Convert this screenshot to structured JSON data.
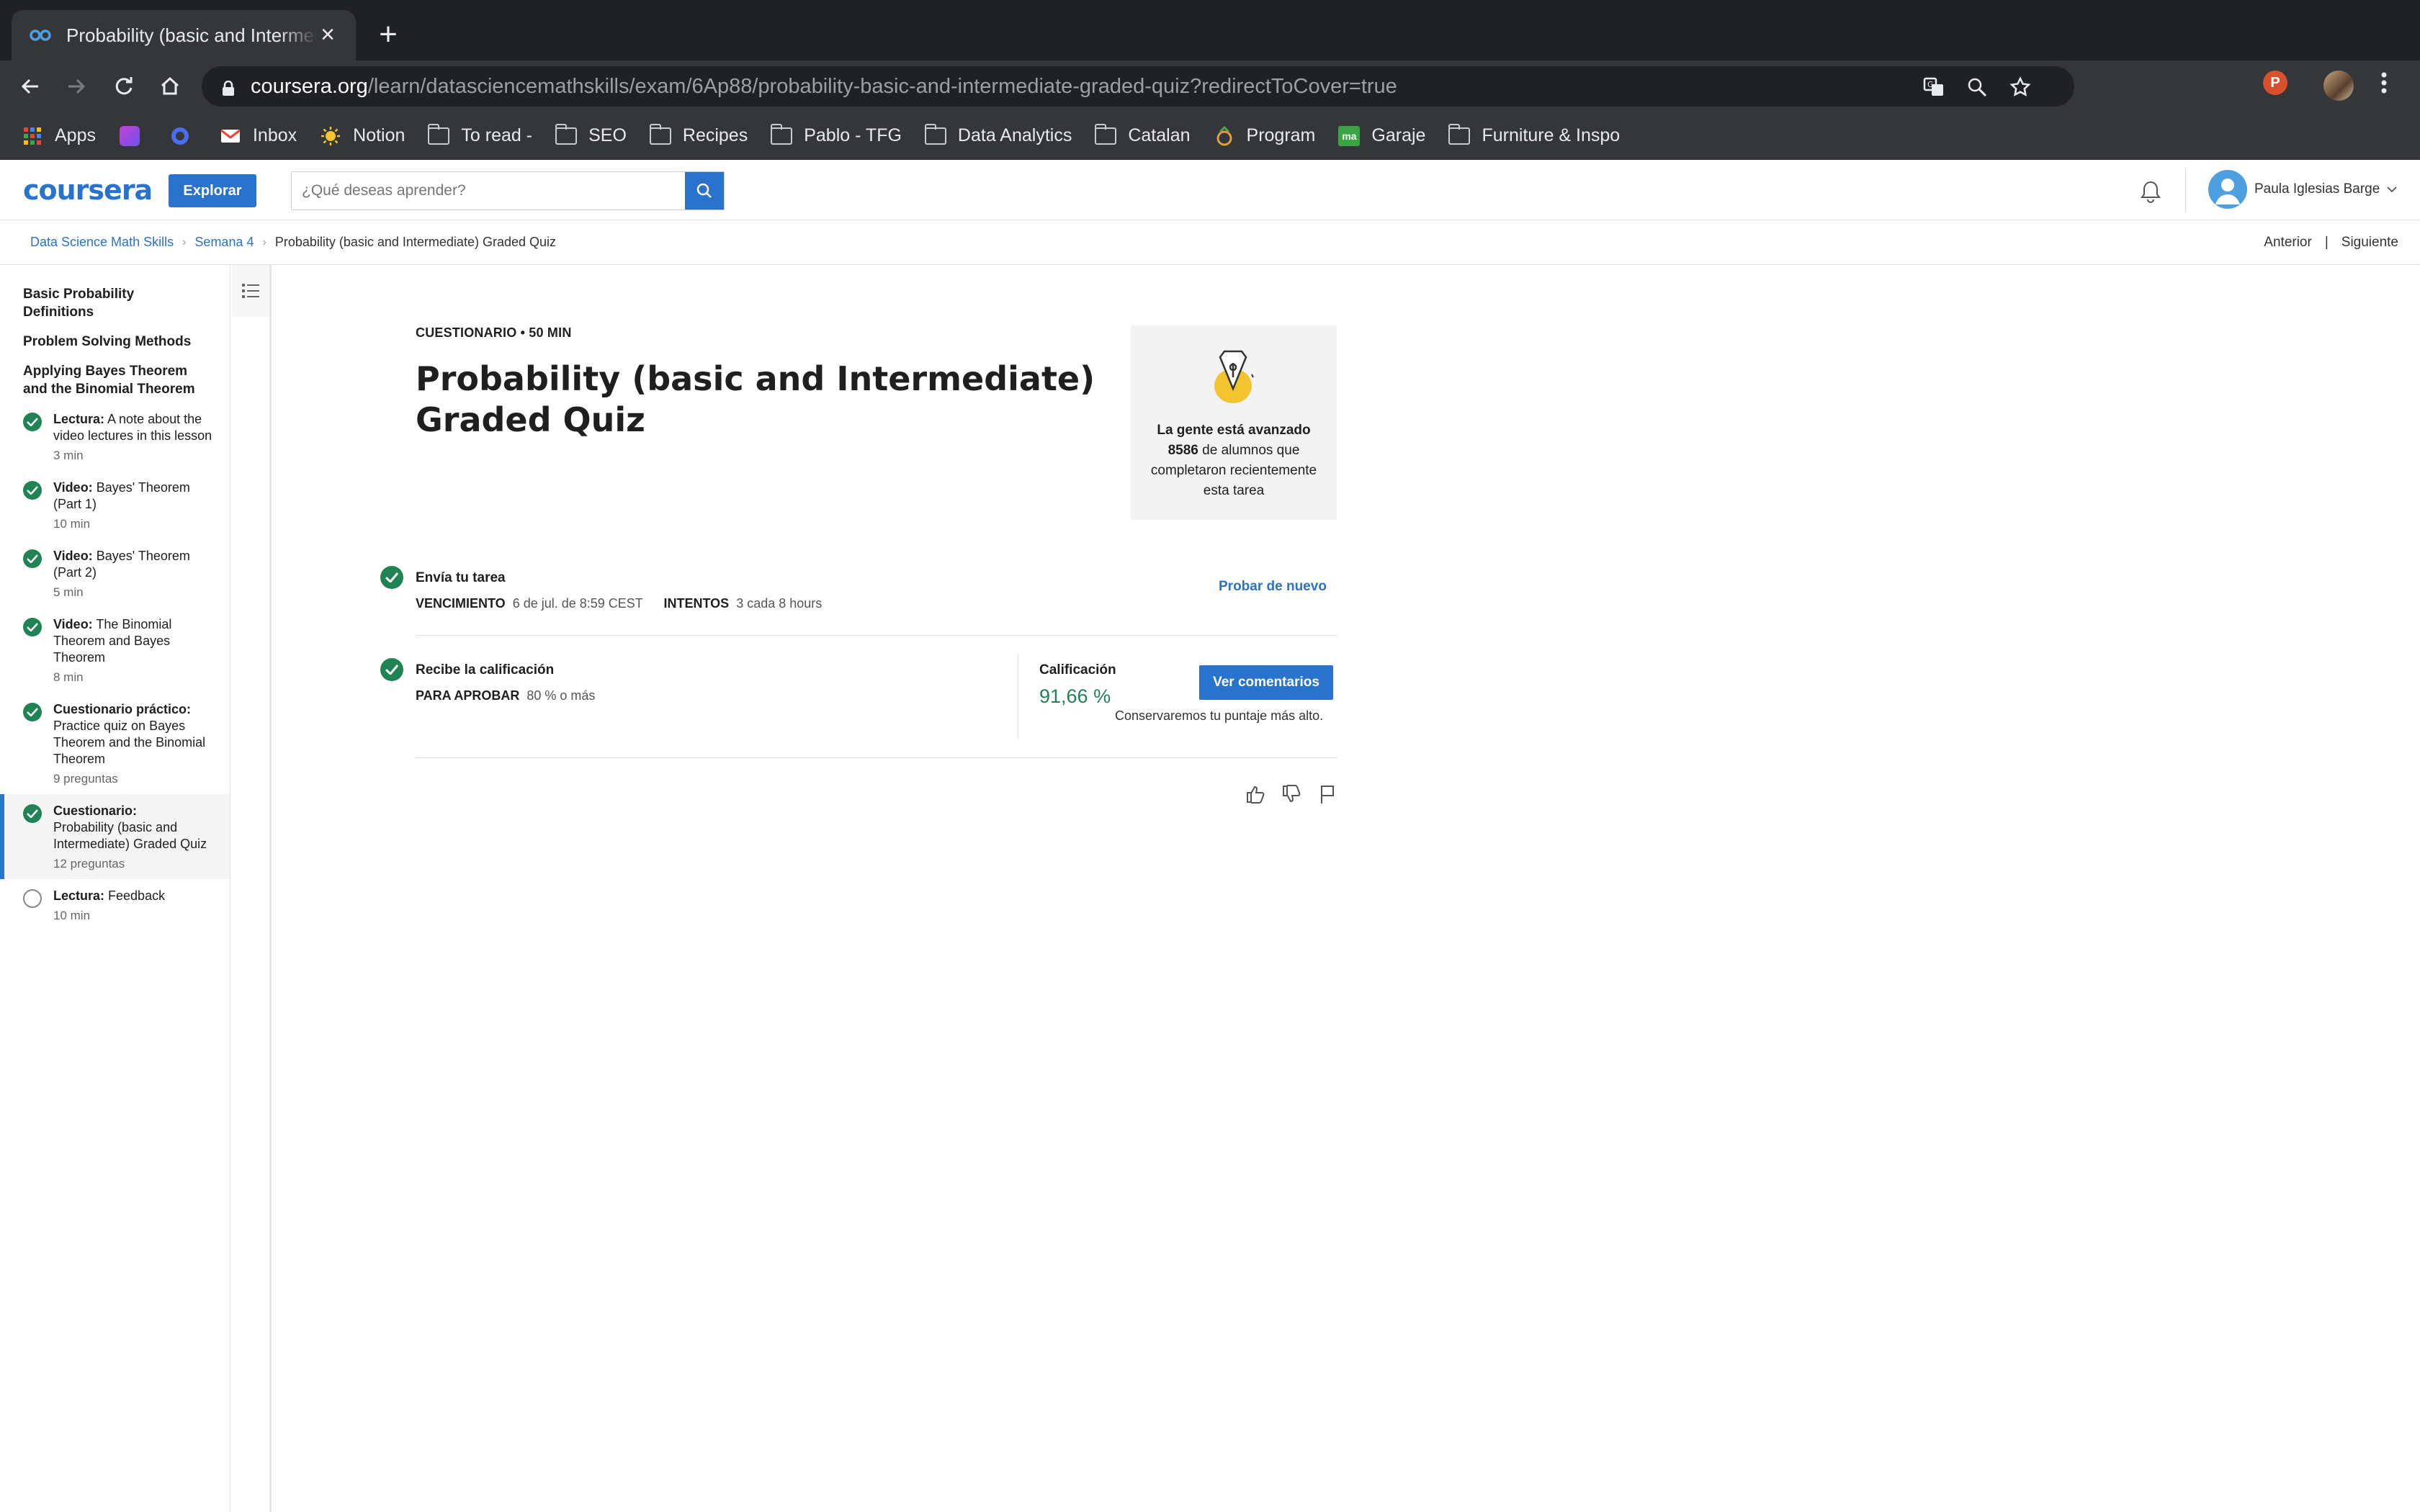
{
  "browser": {
    "tab_title": "Probability (basic and Intermediate) Graded Quiz",
    "url_domain": "coursera.org",
    "url_path": "/learn/datasciencemathskills/exam/6Ap88/probability-basic-and-intermediate-graded-quiz?redirectToCover=true",
    "profile_initial": "P",
    "bookmarks": [
      "Apps",
      "Inbox",
      "Notion",
      "To read -",
      "SEO",
      "Recipes",
      "Pablo - TFG",
      "Data Analytics",
      "Catalan",
      "Program",
      "Garaje",
      "Furniture & Inspo"
    ],
    "garaje_badge": "ma"
  },
  "header": {
    "logo": "coursera",
    "explore_label": "Explorar",
    "search_placeholder": "¿Qué deseas aprender?",
    "user_name": "Paula Iglesias Barge"
  },
  "breadcrumb": {
    "course": "Data Science Math Skills",
    "week": "Semana 4",
    "current": "Probability (basic and Intermediate) Graded Quiz",
    "prev": "Anterior",
    "divider": "|",
    "next": "Siguiente"
  },
  "sidebar": {
    "groups": [
      "Basic Probability Definitions",
      "Problem Solving Methods",
      "Applying Bayes Theorem and the Binomial Theorem"
    ],
    "items": [
      {
        "type": "Lectura:",
        "title": "A note about the video lectures in this lesson",
        "meta": "3 min",
        "done": true
      },
      {
        "type": "Video:",
        "title": "Bayes' Theorem (Part 1)",
        "meta": "10 min",
        "done": true
      },
      {
        "type": "Video:",
        "title": "Bayes' Theorem (Part 2)",
        "meta": "5 min",
        "done": true
      },
      {
        "type": "Video:",
        "title": "The Binomial Theorem and Bayes Theorem",
        "meta": "8 min",
        "done": true
      },
      {
        "type": "Cuestionario práctico:",
        "title": "Practice quiz on Bayes Theorem and the Binomial Theorem",
        "meta": "9 preguntas",
        "done": true
      },
      {
        "type": "Cuestionario:",
        "title": "Probability (basic and Intermediate) Graded Quiz",
        "meta": "12 preguntas",
        "done": true
      },
      {
        "type": "Lectura:",
        "title": "Feedback",
        "meta": "10 min",
        "done": false
      }
    ]
  },
  "main": {
    "kicker": "CUESTIONARIO • 50 MIN",
    "title": "Probability (basic and Intermediate) Graded Quiz",
    "promo": {
      "heading": "La gente está avanzado",
      "count": "8586",
      "text": "de alumnos que completaron recientemente esta tarea"
    },
    "submit": {
      "heading": "Envía tu tarea",
      "due_label": "VENCIMIENTO",
      "due_value": "6 de jul. de 8:59 CEST",
      "attempts_label": "INTENTOS",
      "attempts_value": "3 cada 8 hours",
      "retry": "Probar de nuevo"
    },
    "grade": {
      "heading": "Recibe la calificación",
      "pass_label": "PARA APROBAR",
      "pass_value": "80 % o más",
      "grade_label": "Calificación",
      "grade_value": "91,66 %",
      "feedback_button": "Ver comentarios",
      "keep_note": "Conservaremos tu puntaje más alto."
    }
  },
  "colors": {
    "brand": "#2a73cc",
    "success": "#1f8354"
  }
}
